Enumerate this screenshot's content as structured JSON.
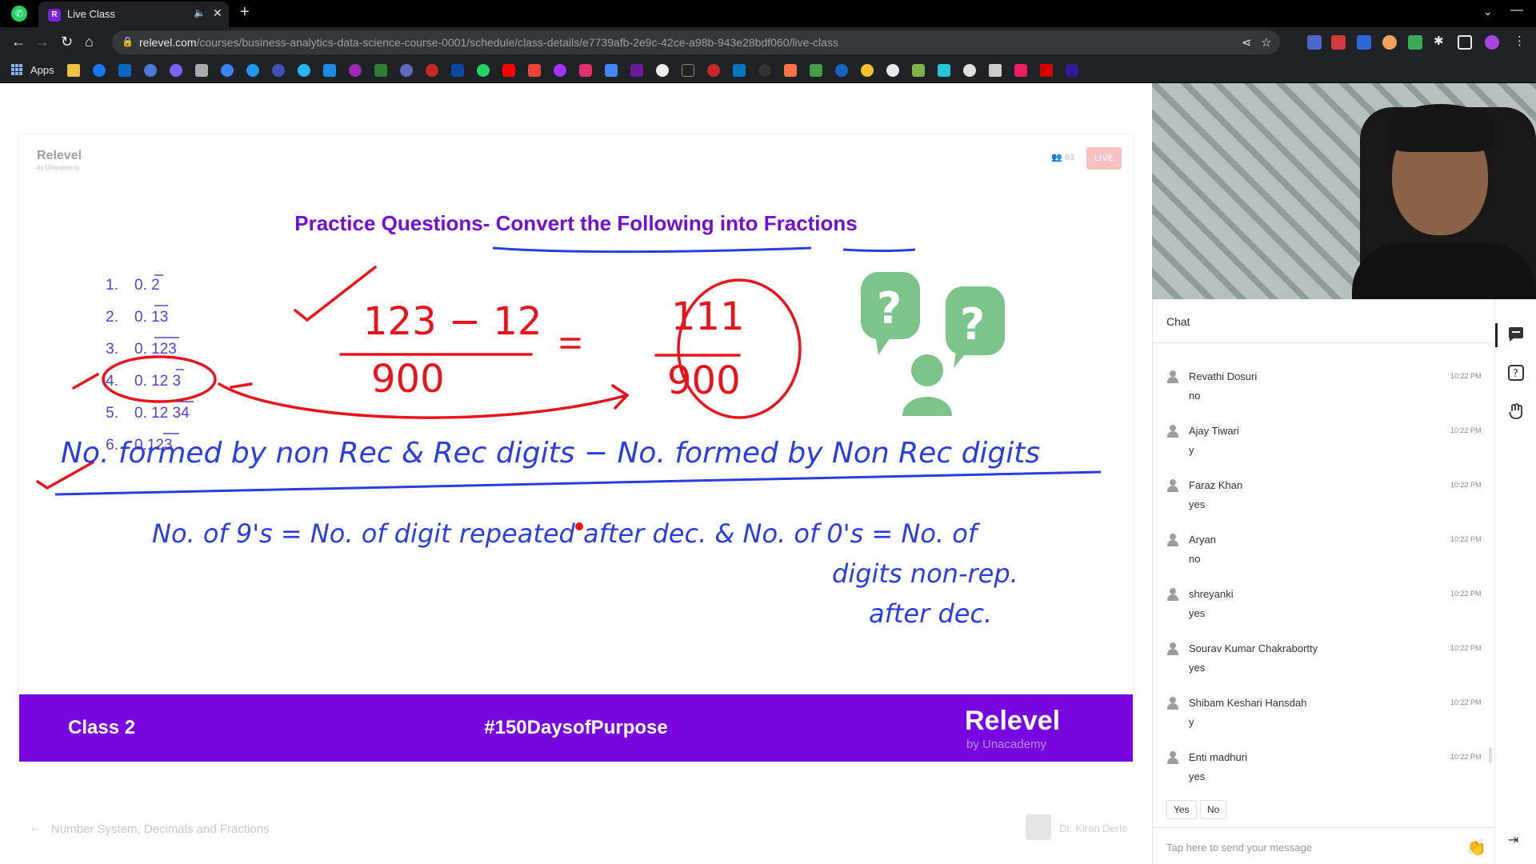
{
  "browser": {
    "tab_title": "Live Class",
    "url_host": "relevel.com",
    "url_path": "/courses/business-analytics-data-science-course-0001/schedule/class-details/e7739afb-2e9c-42ce-a98b-943e28bdf060/live-class",
    "bookmarks_apps_label": "Apps"
  },
  "slide": {
    "brand": "Relevel",
    "brand_sub": "by Unacademy",
    "viewer_count": "63",
    "live_label": "LIVE",
    "title": "Practice Questions- Convert the Following into Fractions",
    "questions": [
      {
        "num": "1.",
        "value": "0. 2"
      },
      {
        "num": "2.",
        "value": "0. 13"
      },
      {
        "num": "3.",
        "value": "0. 123"
      },
      {
        "num": "4.",
        "value": "0. 12 3"
      },
      {
        "num": "5.",
        "value": "0. 12 34"
      },
      {
        "num": "6.",
        "value": "0.123"
      }
    ],
    "handwriting": {
      "numerator": "123 − 12",
      "denominator": "900",
      "equals": "=",
      "result_num": "111",
      "result_den": "900",
      "rule_numerator": "No. formed by non Rec & Rec digits − No. formed by Non Rec digits",
      "rule_denominator_1": "No. of 9's = No. of digit repeated after dec. & No. of 0's = No. of",
      "rule_denominator_2": "digits non-rep.",
      "rule_denominator_3": "after dec."
    },
    "footer_class": "Class 2",
    "footer_hashtag": "#150DaysofPurpose",
    "footer_brand": "Relevel",
    "footer_brand_sub": "by Unacademy"
  },
  "lesson": {
    "title": "Number System, Decimals and Fractions",
    "educator": "Dr. Kiran Derle"
  },
  "chat": {
    "header": "Chat",
    "messages": [
      {
        "name": "Revathi Dosuri",
        "time": "10:22 PM",
        "text": "no"
      },
      {
        "name": "Ajay Tiwari",
        "time": "10:22 PM",
        "text": "y"
      },
      {
        "name": "Faraz Khan",
        "time": "10:22 PM",
        "text": "yes"
      },
      {
        "name": "Aryan",
        "time": "10:22 PM",
        "text": "no"
      },
      {
        "name": "shreyanki",
        "time": "10:22 PM",
        "text": "yes"
      },
      {
        "name": "Sourav Kumar Chakrabortty",
        "time": "10:22 PM",
        "text": "yes"
      },
      {
        "name": "Shibam Keshari Hansdah",
        "time": "10:22 PM",
        "text": "y"
      },
      {
        "name": "Enti madhuri",
        "time": "10:22 PM",
        "text": "yes"
      }
    ],
    "quick_replies": [
      "Yes",
      "No"
    ],
    "input_placeholder": "Tap here to send your message"
  },
  "colors": {
    "brand_purple": "#7806e0",
    "title_purple": "#6f10d3",
    "annotation_red": "#e8141c",
    "annotation_blue": "#2a3ee0",
    "question_mark_green": "#7cc48a"
  }
}
